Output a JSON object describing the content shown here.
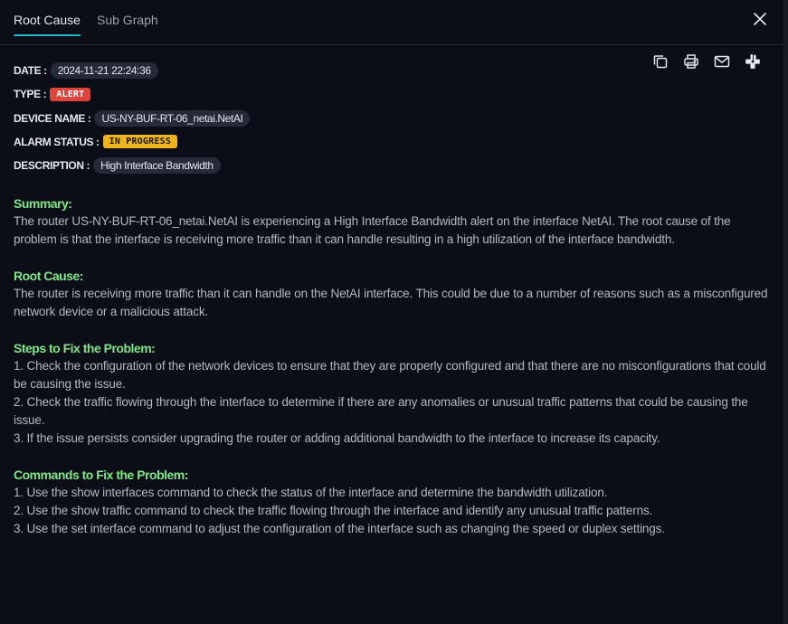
{
  "tabs": {
    "root_cause": "Root Cause",
    "sub_graph": "Sub Graph"
  },
  "meta": {
    "date_label": "DATE :",
    "date_value": "2024-11-21 22:24:36",
    "type_label": "TYPE :",
    "type_value": "ALERT",
    "device_label": "DEVICE NAME :",
    "device_value": "US-NY-BUF-RT-06_netai.NetAI",
    "status_label": "ALARM STATUS :",
    "status_value": "IN PROGRESS",
    "description_label": "DESCRIPTION :",
    "description_value": "High Interface Bandwidth"
  },
  "colors": {
    "accent": "#22b8c9",
    "section_title": "#7ee887",
    "alert": "#e0433b",
    "in_progress": "#f0b41e"
  },
  "actions": [
    "copy-icon",
    "print-icon",
    "mail-icon",
    "slack-icon",
    "close-icon"
  ],
  "sections": {
    "summary": {
      "title": "Summary:",
      "lines": [
        "The router US-NY-BUF-RT-06_netai.NetAI is experiencing a High Interface Bandwidth alert on the interface NetAI. The root cause of the",
        "problem is that the interface is receiving more traffic than it can handle resulting in a high utilization of the interface bandwidth."
      ]
    },
    "root_cause": {
      "title": "Root Cause:",
      "lines": [
        "The router is receiving more traffic than it can handle on the NetAI interface. This could be due to a number of reasons such as a misconfigured",
        "network device or a malicious attack."
      ]
    },
    "steps": {
      "title": "Steps to Fix the Problem:",
      "lines": [
        "1. Check the configuration of the network devices to ensure that they are properly configured and that there are no misconfigurations that could",
        "be causing the issue.",
        "2. Check the traffic flowing through the interface to determine if there are any anomalies or unusual traffic patterns that could be causing the",
        "issue.",
        "3. If the issue persists consider upgrading the router or adding additional bandwidth to the interface to increase its capacity."
      ]
    },
    "commands": {
      "title": "Commands to Fix the Problem:",
      "lines": [
        "1. Use the show interfaces command to check the status of the interface and determine the bandwidth utilization.",
        "2. Use the show traffic command to check the traffic flowing through the interface and identify any unusual traffic patterns.",
        "3. Use the set interface command to adjust the configuration of the interface such as changing the speed or duplex settings."
      ]
    }
  }
}
